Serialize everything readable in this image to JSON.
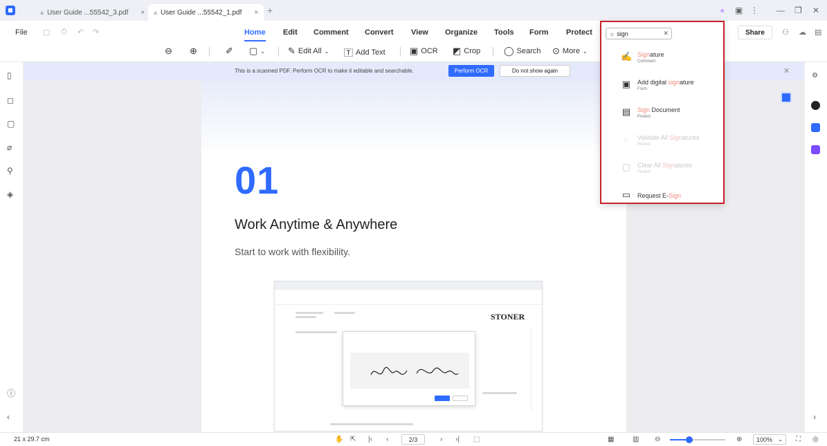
{
  "tabs": [
    {
      "label": "User Guide ...55542_3.pdf",
      "close": "×"
    },
    {
      "label": "User Guide ...55542_1.pdf",
      "close": "×"
    }
  ],
  "new_tab": "+",
  "file_menu": "File",
  "nav_tabs": [
    "Home",
    "Edit",
    "Comment",
    "Convert",
    "View",
    "Organize",
    "Tools",
    "Form",
    "Protect"
  ],
  "toolbar": {
    "edit_all": "Edit All",
    "add_text": "Add Text",
    "ocr": "OCR",
    "crop": "Crop",
    "search": "Search",
    "more": "More"
  },
  "share_label": "Share",
  "ocr_banner": {
    "message": "This is a scanned PDF. Perform OCR to make it editable and searchable.",
    "perform_label": "Perform OCR",
    "dismiss_label": "Do not show again"
  },
  "page": {
    "number": "01",
    "headline": "Work Anytime & Anywhere",
    "subline": "Start to work with flexibility.",
    "mini_logo": "STONER"
  },
  "search": {
    "query": "sign",
    "results": [
      {
        "pre": "",
        "hl": "Sign",
        "post": "ature",
        "sub": "Comment",
        "icon": "✍",
        "enabled": true
      },
      {
        "pre": "Add digital ",
        "hl": "sign",
        "post": "ature",
        "sub": "Form",
        "icon": "▣",
        "enabled": true
      },
      {
        "pre": "",
        "hl": "Sign",
        "post": " Document",
        "sub": "Protect",
        "icon": "▤",
        "enabled": true
      },
      {
        "pre": "Validate All ",
        "hl": "Sign",
        "post": "atures",
        "sub": "Protect",
        "icon": "◌",
        "enabled": false
      },
      {
        "pre": "Clear All ",
        "hl": "Sign",
        "post": "atures",
        "sub": "Protect",
        "icon": "▢",
        "enabled": false
      },
      {
        "pre": "Request E-",
        "hl": "Sign",
        "post": "",
        "sub": "",
        "icon": "▭",
        "enabled": true
      }
    ]
  },
  "status": {
    "page_size": "21 x 29.7 cm",
    "page_indicator": "2/3",
    "zoom": "100%",
    "zoom_fraction": 0.35
  },
  "colors": {
    "accent": "#2f6bff",
    "highlight": "#c8202a",
    "match": "#f08a7c"
  }
}
